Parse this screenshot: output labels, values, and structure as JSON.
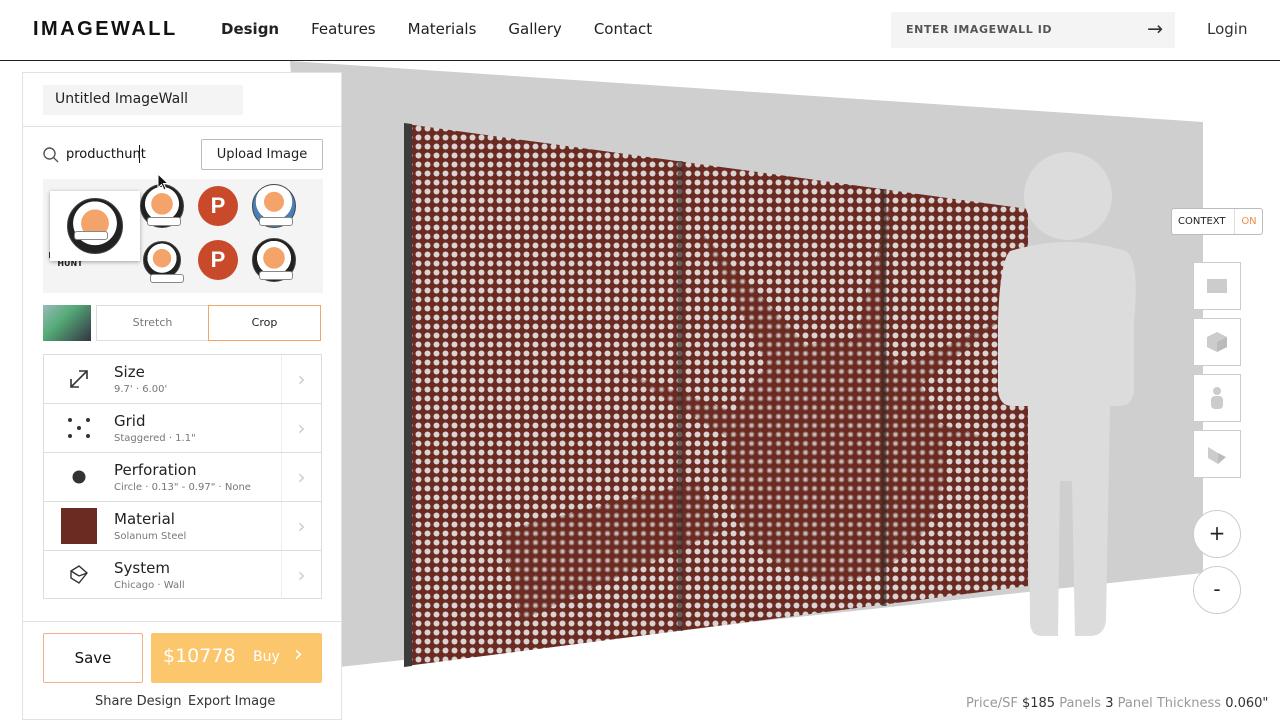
{
  "header": {
    "logo": "IMAGEWALL",
    "nav": [
      {
        "label": "Design",
        "active": true
      },
      {
        "label": "Features",
        "active": false
      },
      {
        "label": "Materials",
        "active": false
      },
      {
        "label": "Gallery",
        "active": false
      },
      {
        "label": "Contact",
        "active": false
      }
    ],
    "id_placeholder": "ENTER IMAGEWALL ID",
    "login": "Login"
  },
  "panel": {
    "title": "Untitled ImageWall",
    "search_value": "producthunt",
    "upload_label": "Upload Image",
    "results_icons": [
      "cat-logo-icon",
      "cat-logo-icon",
      "producthunt-p-icon",
      "producthunt-text-logo-icon",
      "producthunt-text-logo-icon",
      "cat-logo-icon",
      "producthunt-p-icon",
      "cat-logo-icon"
    ],
    "mode": {
      "stretch": "Stretch",
      "crop": "Crop",
      "selected": "Crop"
    },
    "properties": [
      {
        "title": "Size",
        "sub": "9.7' · 6.00'",
        "icon": "resize-arrow-icon"
      },
      {
        "title": "Grid",
        "sub": "Staggered · 1.1\"",
        "icon": "grid-dots-icon"
      },
      {
        "title": "Perforation",
        "sub": "Circle · 0.13\" - 0.97\" · None",
        "icon": "circle-dot-icon"
      },
      {
        "title": "Material",
        "sub": "Solanum Steel",
        "icon": "material-swatch-icon",
        "color": "#6b2b22"
      },
      {
        "title": "System",
        "sub": "Chicago · Wall",
        "icon": "cube-outline-icon"
      }
    ],
    "save_label": "Save",
    "price": "$10778",
    "buy_label": "Buy",
    "share_label": "Share Design",
    "export_label": "Export Image"
  },
  "viewport": {
    "context_label": "CONTEXT",
    "context_state": "ON",
    "view_icons": [
      "front-view-icon",
      "iso-view-icon",
      "person-view-icon",
      "corner-view-icon"
    ],
    "zoom_in": "+",
    "zoom_out": "-",
    "panel_color": "#6b2b22",
    "accent": "#f08a4a",
    "buy_color": "#fcc66d"
  },
  "footer": {
    "price_sf_label": "Price/SF",
    "price_sf_value": "$185",
    "panels_label": "Panels",
    "panels_value": "3",
    "thickness_label": "Panel Thickness",
    "thickness_value": "0.060\""
  }
}
